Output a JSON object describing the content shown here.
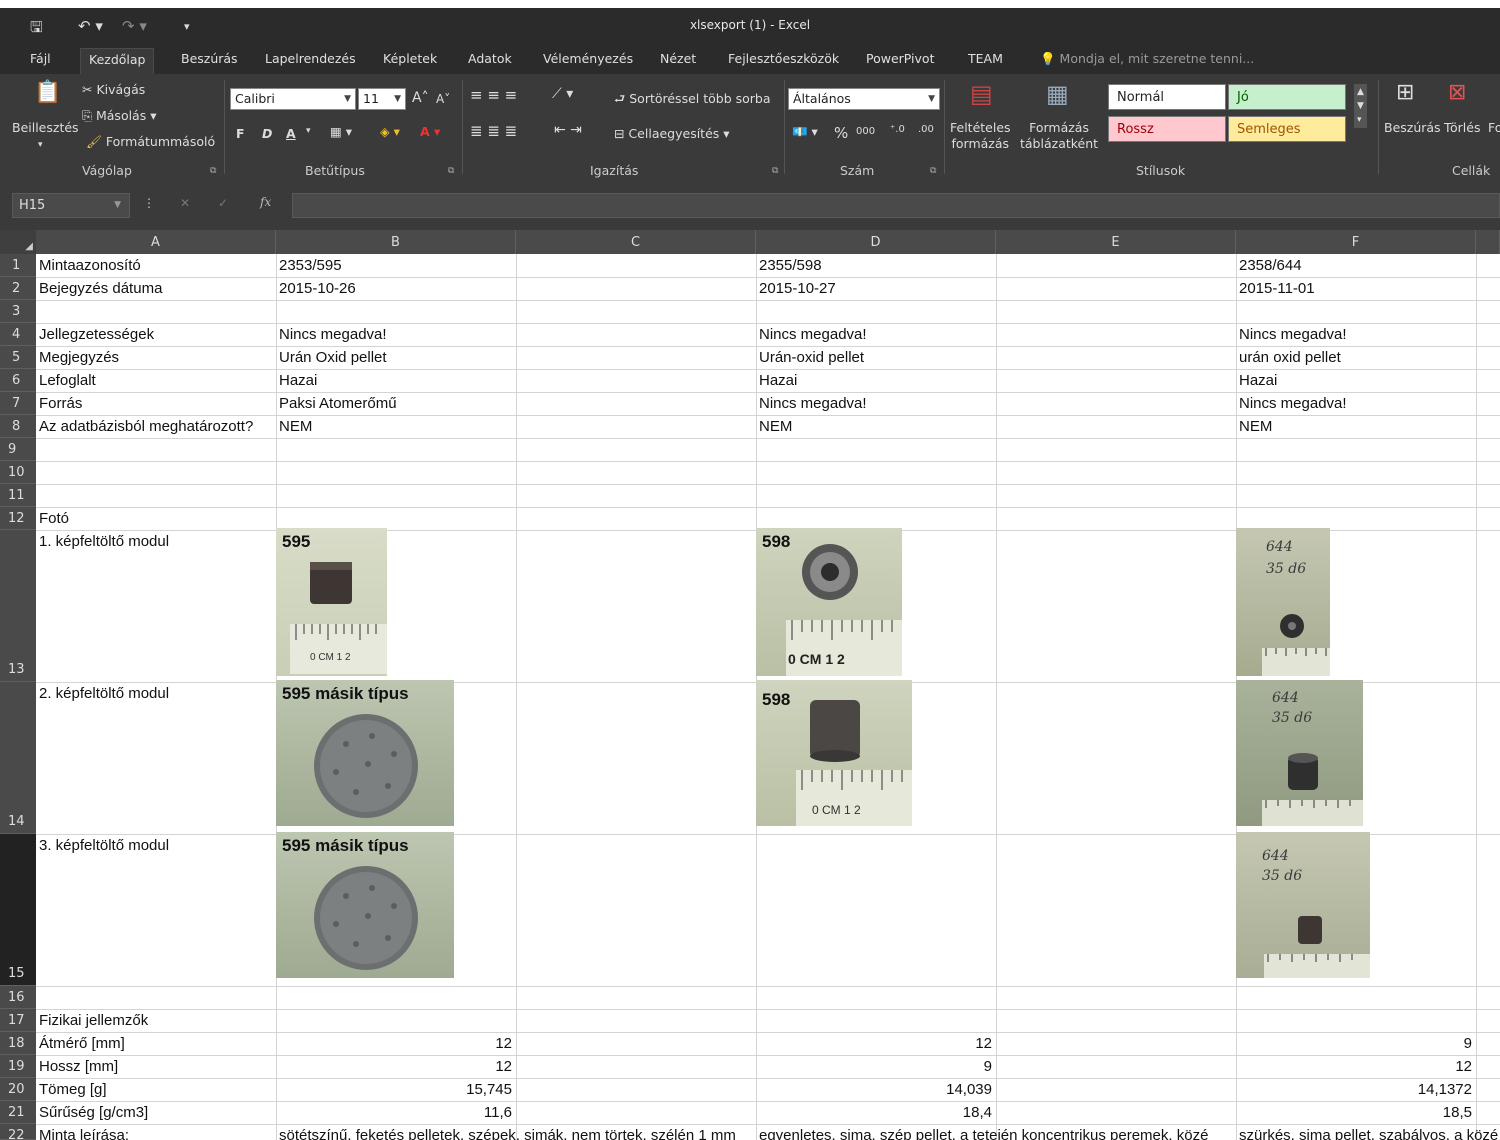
{
  "window": {
    "title": "xlsexport (1) - Excel"
  },
  "tabs": [
    "Fájl",
    "Kezdőlap",
    "Beszúrás",
    "Lapelrendezés",
    "Képletek",
    "Adatok",
    "Véleményezés",
    "Nézet",
    "Fejlesztőeszközök",
    "PowerPivot",
    "TEAM"
  ],
  "tell_me": "Mondja el, mit szeretne tenni...",
  "ribbon": {
    "clipboard": {
      "paste": "Beillesztés",
      "cut": "Kivágás",
      "copy": "Másolás",
      "format_painter": "Formátummásoló",
      "group": "Vágólap"
    },
    "font": {
      "name": "Calibri",
      "size": "11",
      "bold": "F",
      "italic": "D",
      "underline": "A",
      "group": "Betűtípus"
    },
    "alignment": {
      "wrap": "Sortöréssel több sorba",
      "merge": "Cellaegyesítés",
      "group": "Igazítás"
    },
    "number": {
      "format": "Általános",
      "percent": "%",
      "thousands": "000",
      "group": "Szám"
    },
    "styles": {
      "conditional": "Feltételes\nformázás",
      "as_table": "Formázás\ntáblázatként",
      "normal": "Normál",
      "good": "Jó",
      "bad": "Rossz",
      "neutral": "Semleges",
      "group": "Stílusok"
    },
    "cells": {
      "insert": "Beszúrás",
      "delete": "Törlés",
      "format": "Fo",
      "group": "Cellák"
    }
  },
  "namebox": "H15",
  "columns": [
    "A",
    "B",
    "C",
    "D",
    "E",
    "F"
  ],
  "rows": [
    "1",
    "2",
    "3",
    "4",
    "5",
    "6",
    "7",
    "8",
    "9",
    "10",
    "11",
    "12",
    "13",
    "14",
    "15",
    "16",
    "17",
    "18",
    "19",
    "20",
    "21",
    "22"
  ],
  "cells": {
    "A1": "Mintaazonosító",
    "B1": "2353/595",
    "D1": "2355/598",
    "F1": "2358/644",
    "A2": "Bejegyzés dátuma",
    "B2": "2015-10-26",
    "D2": "2015-10-27",
    "F2": "2015-11-01",
    "A4": "Jellegzetességek",
    "B4": "Nincs megadva!",
    "D4": "Nincs megadva!",
    "F4": "Nincs megadva!",
    "A5": "Megjegyzés",
    "B5": "Urán Oxid pellet",
    "D5": "Urán-oxid pellet",
    "F5": "urán oxid pellet",
    "A6": "Lefoglalt",
    "B6": "Hazai",
    "D6": "Hazai",
    "F6": "Hazai",
    "A7": "Forrás",
    "B7": "Paksi Atomerőmű",
    "D7": "Nincs megadva!",
    "F7": "Nincs megadva!",
    "A8": "Az adatbázisból meghatározott?",
    "B8": "NEM",
    "D8": "NEM",
    "F8": "NEM",
    "A12": "Fotó",
    "A13": "1. képfeltöltő modul",
    "A14": "2. képfeltöltő modul",
    "A15": "3. képfeltöltő modul",
    "A17": "Fizikai jellemzők",
    "A18": "Átmérő [mm]",
    "B18": "12",
    "D18": "12",
    "F18": "9",
    "A19": "Hossz [mm]",
    "B19": "12",
    "D19": "9",
    "F19": "12",
    "A20": "Tömeg [g]",
    "B20": "15,745",
    "D20": "14,039",
    "F20": "14,1372",
    "A21": "Sűrűség [g/cm3]",
    "B21": "11,6",
    "D21": "18,4",
    "F21": "18,5",
    "A22": "Minta leírása:",
    "B22": "sötétszínű, feketés pelletek, szépek, simák, nem törtek, szélén 1 mm",
    "D22": "egyenletes, sima, szép pellet, a tetején koncentrikus peremek, közé",
    "F22": "szürkés, sima pellet, szabályos, a közé"
  },
  "photos": {
    "b13": "595",
    "b14": "595 másik típus",
    "b15": "595 másik típus",
    "d13": "598",
    "d14": "598",
    "f13": "644\n35 d6",
    "f14": "644\n35 d6",
    "f15": "644\n35 d6",
    "ruler": "0 CM 1  2"
  }
}
